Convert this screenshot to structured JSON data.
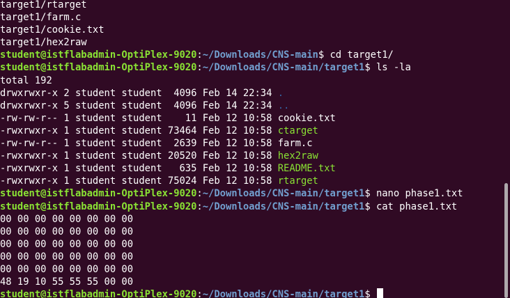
{
  "terminal": {
    "colors": {
      "background": "#300a24",
      "text": "#ffffff",
      "user_host": "#8ae234",
      "path": "#729fcf",
      "directory": "#3465a4",
      "executable": "#8ae234"
    },
    "lines": [
      {
        "type": "output",
        "segments": [
          {
            "text": "target1/rtarget",
            "style": "plain"
          }
        ]
      },
      {
        "type": "output",
        "segments": [
          {
            "text": "target1/farm.c",
            "style": "plain"
          }
        ]
      },
      {
        "type": "output",
        "segments": [
          {
            "text": "target1/cookie.txt",
            "style": "plain"
          }
        ]
      },
      {
        "type": "output",
        "segments": [
          {
            "text": "target1/hex2raw",
            "style": "plain"
          }
        ]
      },
      {
        "type": "prompt",
        "segments": [
          {
            "text": "student@istflabadmin-OptiPlex-9020",
            "style": "user"
          },
          {
            "text": ":",
            "style": "plain"
          },
          {
            "text": "~/Downloads/CNS-main",
            "style": "path"
          },
          {
            "text": "$ cd target1/",
            "style": "plain"
          }
        ]
      },
      {
        "type": "prompt",
        "segments": [
          {
            "text": "student@istflabadmin-OptiPlex-9020",
            "style": "user"
          },
          {
            "text": ":",
            "style": "plain"
          },
          {
            "text": "~/Downloads/CNS-main/target1",
            "style": "path"
          },
          {
            "text": "$ ls -la",
            "style": "plain"
          }
        ]
      },
      {
        "type": "output",
        "segments": [
          {
            "text": "total 192",
            "style": "plain"
          }
        ]
      },
      {
        "type": "output",
        "segments": [
          {
            "text": "drwxrwxr-x 2 student student  4096 Feb 14 22:34 ",
            "style": "plain"
          },
          {
            "text": ".",
            "style": "dir"
          }
        ]
      },
      {
        "type": "output",
        "segments": [
          {
            "text": "drwxrwxr-x 5 student student  4096 Feb 14 22:34 ",
            "style": "plain"
          },
          {
            "text": "..",
            "style": "dir"
          }
        ]
      },
      {
        "type": "output",
        "segments": [
          {
            "text": "-rw-rw-r-- 1 student student    11 Feb 12 10:58 cookie.txt",
            "style": "plain"
          }
        ]
      },
      {
        "type": "output",
        "segments": [
          {
            "text": "-rwxrwxr-x 1 student student 73464 Feb 12 10:58 ",
            "style": "plain"
          },
          {
            "text": "ctarget",
            "style": "exe"
          }
        ]
      },
      {
        "type": "output",
        "segments": [
          {
            "text": "-rw-rw-r-- 1 student student  2639 Feb 12 10:58 farm.c",
            "style": "plain"
          }
        ]
      },
      {
        "type": "output",
        "segments": [
          {
            "text": "-rwxrwxr-x 1 student student 20520 Feb 12 10:58 ",
            "style": "plain"
          },
          {
            "text": "hex2raw",
            "style": "exe"
          }
        ]
      },
      {
        "type": "output",
        "segments": [
          {
            "text": "-rwxrwxr-x 1 student student   635 Feb 12 10:58 ",
            "style": "plain"
          },
          {
            "text": "README.txt",
            "style": "exe"
          }
        ]
      },
      {
        "type": "output",
        "segments": [
          {
            "text": "-rwxrwxr-x 1 student student 75024 Feb 12 10:58 ",
            "style": "plain"
          },
          {
            "text": "rtarget",
            "style": "exe"
          }
        ]
      },
      {
        "type": "prompt",
        "segments": [
          {
            "text": "student@istflabadmin-OptiPlex-9020",
            "style": "user"
          },
          {
            "text": ":",
            "style": "plain"
          },
          {
            "text": "~/Downloads/CNS-main/target1",
            "style": "path"
          },
          {
            "text": "$ nano phase1.txt",
            "style": "plain"
          }
        ]
      },
      {
        "type": "prompt",
        "segments": [
          {
            "text": "student@istflabadmin-OptiPlex-9020",
            "style": "user"
          },
          {
            "text": ":",
            "style": "plain"
          },
          {
            "text": "~/Downloads/CNS-main/target1",
            "style": "path"
          },
          {
            "text": "$ cat phase1.txt",
            "style": "plain"
          }
        ]
      },
      {
        "type": "output",
        "segments": [
          {
            "text": "00 00 00 00 00 00 00 00",
            "style": "plain"
          }
        ]
      },
      {
        "type": "output",
        "segments": [
          {
            "text": "00 00 00 00 00 00 00 00",
            "style": "plain"
          }
        ]
      },
      {
        "type": "output",
        "segments": [
          {
            "text": "00 00 00 00 00 00 00 00",
            "style": "plain"
          }
        ]
      },
      {
        "type": "output",
        "segments": [
          {
            "text": "00 00 00 00 00 00 00 00",
            "style": "plain"
          }
        ]
      },
      {
        "type": "output",
        "segments": [
          {
            "text": "00 00 00 00 00 00 00 00",
            "style": "plain"
          }
        ]
      },
      {
        "type": "output",
        "segments": [
          {
            "text": "48 19 10 55 55 55 00 00",
            "style": "plain"
          }
        ]
      },
      {
        "type": "prompt",
        "cursor": true,
        "segments": [
          {
            "text": "student@istflabadmin-OptiPlex-9020",
            "style": "user"
          },
          {
            "text": ":",
            "style": "plain"
          },
          {
            "text": "~/Downloads/CNS-main/target1",
            "style": "path"
          },
          {
            "text": "$ ",
            "style": "plain"
          }
        ]
      }
    ]
  }
}
